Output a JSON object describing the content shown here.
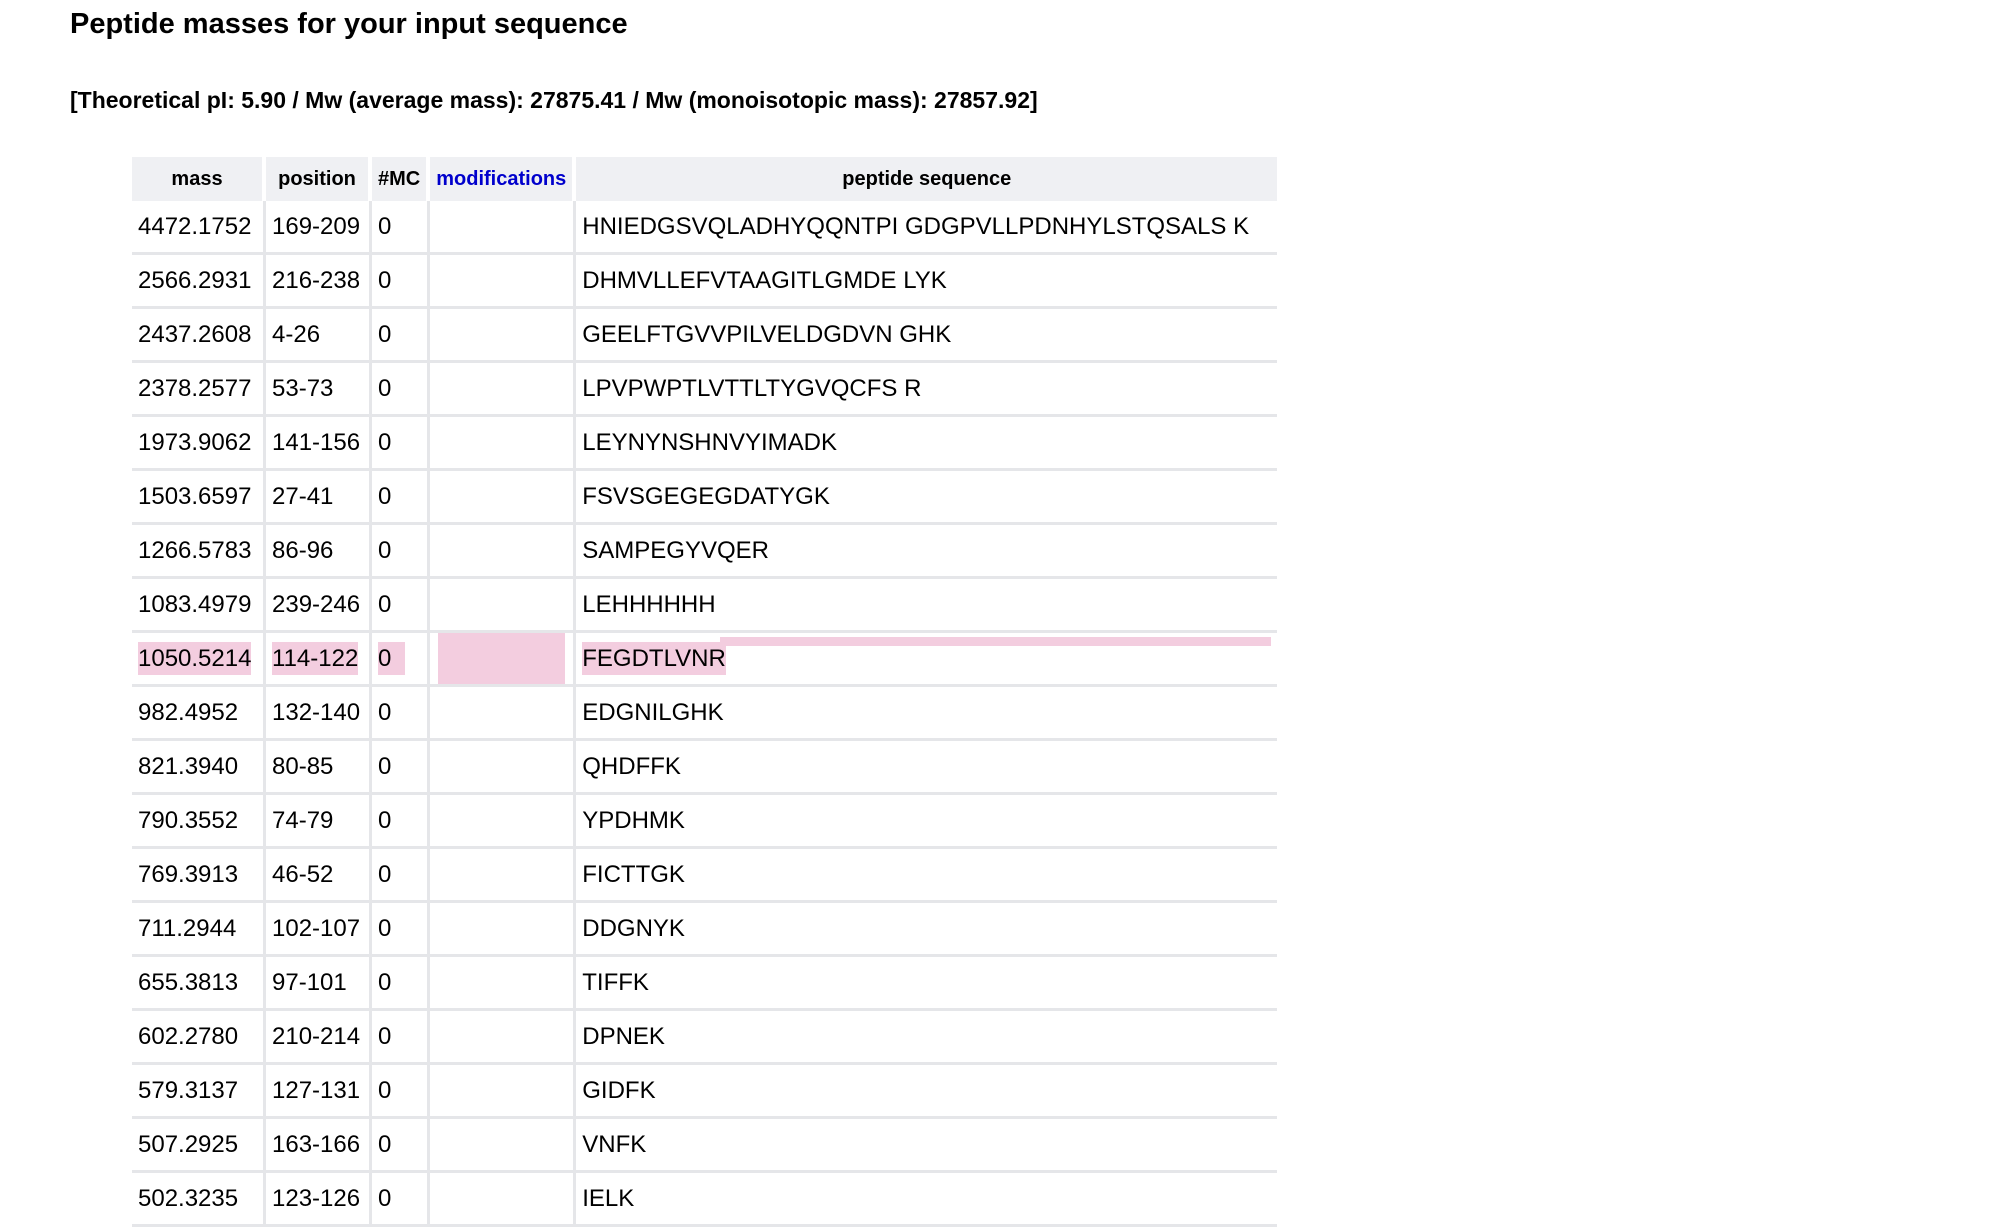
{
  "page": {
    "title": "Peptide masses for your input sequence",
    "summary": "[Theoretical pI: 5.90 / Mw (average mass): 27875.41 / Mw (monoisotopic mass): 27857.92]"
  },
  "table": {
    "headers": {
      "mass": "mass",
      "position": "position",
      "mc": "#MC",
      "modifications": "modifications",
      "sequence": "peptide sequence"
    },
    "highlight_color": "#f3cddf",
    "link_color": "#0000cc",
    "rows": [
      {
        "mass": "4472.1752",
        "position": "169-209",
        "mc": "0",
        "modifications": "",
        "sequence": "HNIEDGSVQLADHYQQNTPI GDGPVLLPDNHYLSTQSALS K"
      },
      {
        "mass": "2566.2931",
        "position": "216-238",
        "mc": "0",
        "modifications": "",
        "sequence": "DHMVLLEFVTAAGITLGMDE LYK"
      },
      {
        "mass": "2437.2608",
        "position": "4-26",
        "mc": "0",
        "modifications": "",
        "sequence": "GEELFTGVVPILVELDGDVN GHK"
      },
      {
        "mass": "2378.2577",
        "position": "53-73",
        "mc": "0",
        "modifications": "",
        "sequence": "LPVPWPTLVTTLTYGVQCFS R"
      },
      {
        "mass": "1973.9062",
        "position": "141-156",
        "mc": "0",
        "modifications": "",
        "sequence": "LEYNYNSHNVYIMADK"
      },
      {
        "mass": "1503.6597",
        "position": "27-41",
        "mc": "0",
        "modifications": "",
        "sequence": "FSVSGEGEGDATYGK"
      },
      {
        "mass": "1266.5783",
        "position": "86-96",
        "mc": "0",
        "modifications": "",
        "sequence": "SAMPEGYVQER"
      },
      {
        "mass": "1083.4979",
        "position": "239-246",
        "mc": "0",
        "modifications": "",
        "sequence": "LEHHHHHH"
      },
      {
        "mass": "1050.5214",
        "position": "114-122",
        "mc": "0",
        "modifications": "",
        "sequence": "FEGDTLVNR",
        "highlighted": true
      },
      {
        "mass": "982.4952",
        "position": "132-140",
        "mc": "0",
        "modifications": "",
        "sequence": "EDGNILGHK"
      },
      {
        "mass": "821.3940",
        "position": "80-85",
        "mc": "0",
        "modifications": "",
        "sequence": "QHDFFK"
      },
      {
        "mass": "790.3552",
        "position": "74-79",
        "mc": "0",
        "modifications": "",
        "sequence": "YPDHMK"
      },
      {
        "mass": "769.3913",
        "position": "46-52",
        "mc": "0",
        "modifications": "",
        "sequence": "FICTTGK"
      },
      {
        "mass": "711.2944",
        "position": "102-107",
        "mc": "0",
        "modifications": "",
        "sequence": "DDGNYK"
      },
      {
        "mass": "655.3813",
        "position": "97-101",
        "mc": "0",
        "modifications": "",
        "sequence": "TIFFK"
      },
      {
        "mass": "602.2780",
        "position": "210-214",
        "mc": "0",
        "modifications": "",
        "sequence": "DPNEK"
      },
      {
        "mass": "579.3137",
        "position": "127-131",
        "mc": "0",
        "modifications": "",
        "sequence": "GIDFK"
      },
      {
        "mass": "507.2925",
        "position": "163-166",
        "mc": "0",
        "modifications": "",
        "sequence": "VNFK"
      },
      {
        "mass": "502.3235",
        "position": "123-126",
        "mc": "0",
        "modifications": "",
        "sequence": "IELK"
      }
    ]
  }
}
